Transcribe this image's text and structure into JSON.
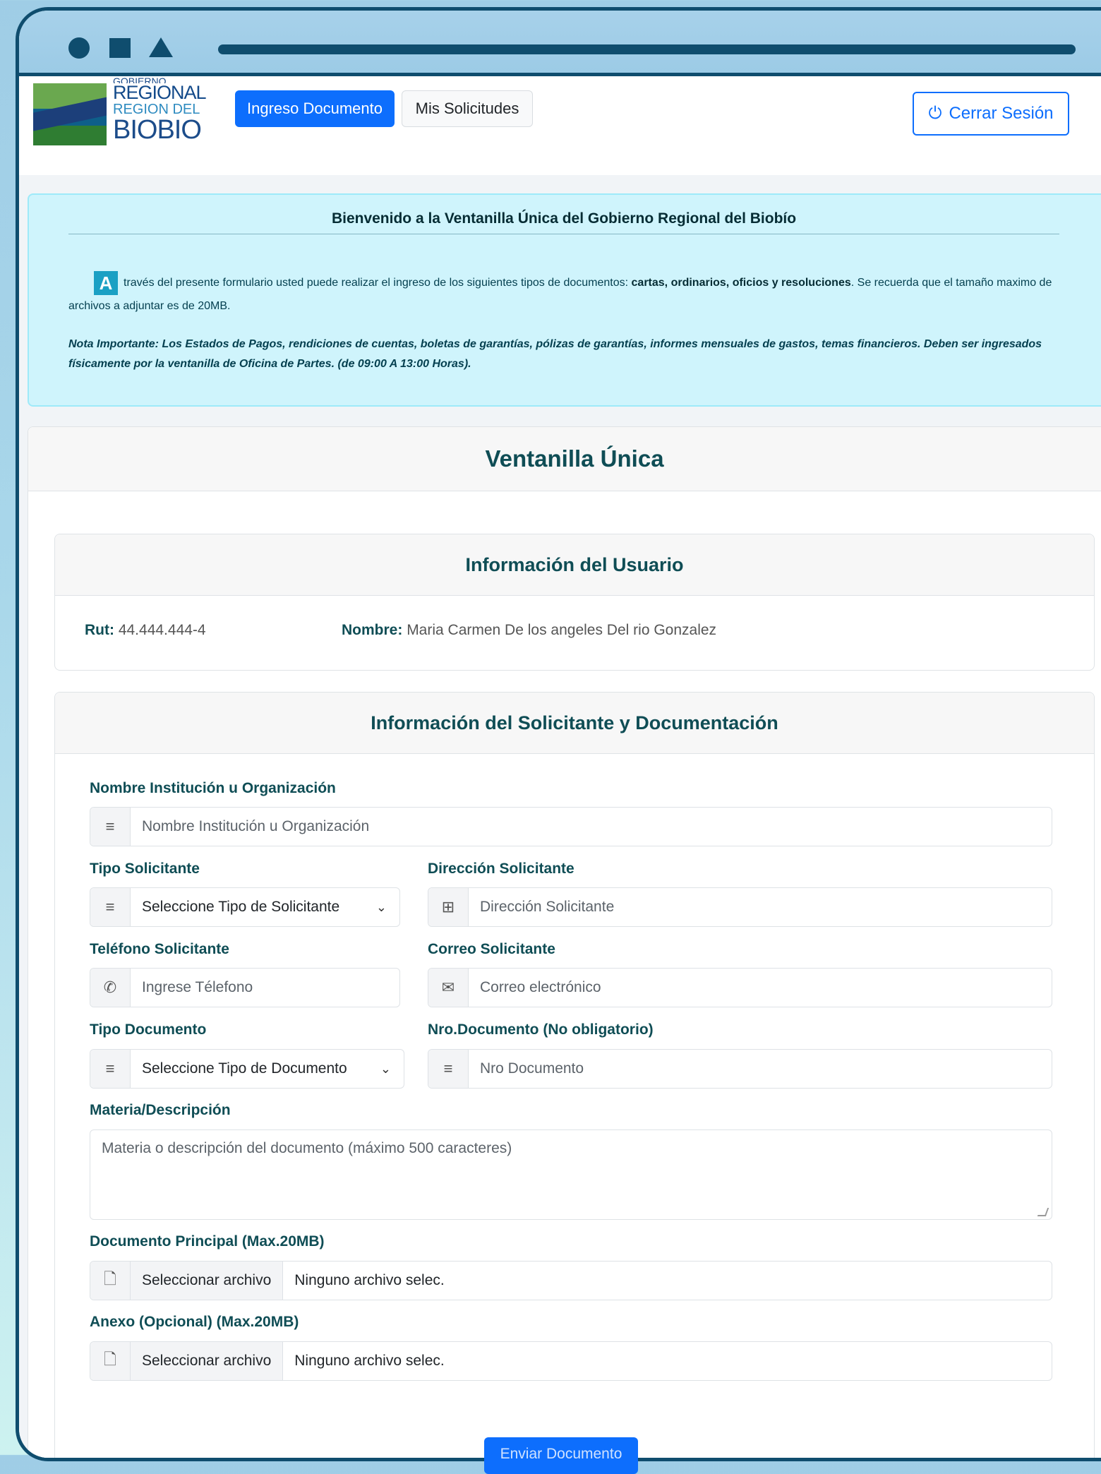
{
  "nav": {
    "logo_lines": [
      "GOBIERNO",
      "REGIONAL",
      "REGION DEL",
      "BIOBIO"
    ],
    "ingreso_label": "Ingreso Documento",
    "solicitudes_label": "Mis Solicitudes",
    "logout_label": "Cerrar Sesión"
  },
  "welcome": {
    "title": "Bienvenido a la Ventanilla Única del Gobierno Regional del Biobío",
    "drop_cap": "A",
    "p1_start": "través del presente formulario usted puede realizar el ingreso de los siguientes tipos de documentos: ",
    "p1_bold": "cartas, ordinarios, oficios y resoluciones",
    "p1_end": ". Se recuerda que el tamaño maximo de archivos a adjuntar es de 20MB.",
    "note": "Nota Importante: Los Estados de Pagos, rendiciones de cuentas, boletas de garantías, pólizas de garantías, informes mensuales de gastos, temas financieros. Deben ser ingresados físicamente por la ventanilla de Oficina de Partes. (de 09:00 A 13:00 Horas)."
  },
  "main_title": "Ventanilla Única",
  "user_info": {
    "title": "Información del Usuario",
    "rut_label": "Rut:",
    "rut_value": "44.444.444-4",
    "name_label": "Nombre:",
    "name_value": "Maria Carmen De los angeles Del rio Gonzalez"
  },
  "form": {
    "title": "Información del Solicitante y Documentación",
    "institution": {
      "label": "Nombre Institución u Organización",
      "placeholder": "Nombre Institución u Organización",
      "icon": "list-icon"
    },
    "tipo_solicitante": {
      "label": "Tipo Solicitante",
      "value": "Seleccione Tipo de Solicitante",
      "icon": "list-icon"
    },
    "direccion": {
      "label": "Dirección Solicitante",
      "placeholder": "Dirección Solicitante",
      "icon": "signpost-icon"
    },
    "telefono": {
      "label": "Teléfono Solicitante",
      "placeholder": "Ingrese Télefono",
      "icon": "phone-icon"
    },
    "correo": {
      "label": "Correo Solicitante",
      "placeholder": "Correo electrónico",
      "icon": "envelope-icon"
    },
    "tipo_documento": {
      "label": "Tipo Documento",
      "value": "Seleccione Tipo de Documento",
      "icon": "list-icon"
    },
    "nro_documento": {
      "label": "Nro.Documento (No obligatorio)",
      "placeholder": "Nro Documento",
      "icon": "list-icon"
    },
    "materia": {
      "label": "Materia/Descripción",
      "placeholder": "Materia o descripción del documento (máximo 500 caracteres)"
    },
    "doc_principal": {
      "label": "Documento Principal (Max.20MB)",
      "button": "Seleccionar archivo",
      "status": "Ninguno archivo selec.",
      "icon": "pdf-file-icon"
    },
    "anexo": {
      "label": "Anexo (Opcional) (Max.20MB)",
      "button": "Seleccionar archivo",
      "status": "Ninguno archivo selec.",
      "icon": "pdf-file-icon"
    },
    "submit_label": "Enviar Documento"
  }
}
